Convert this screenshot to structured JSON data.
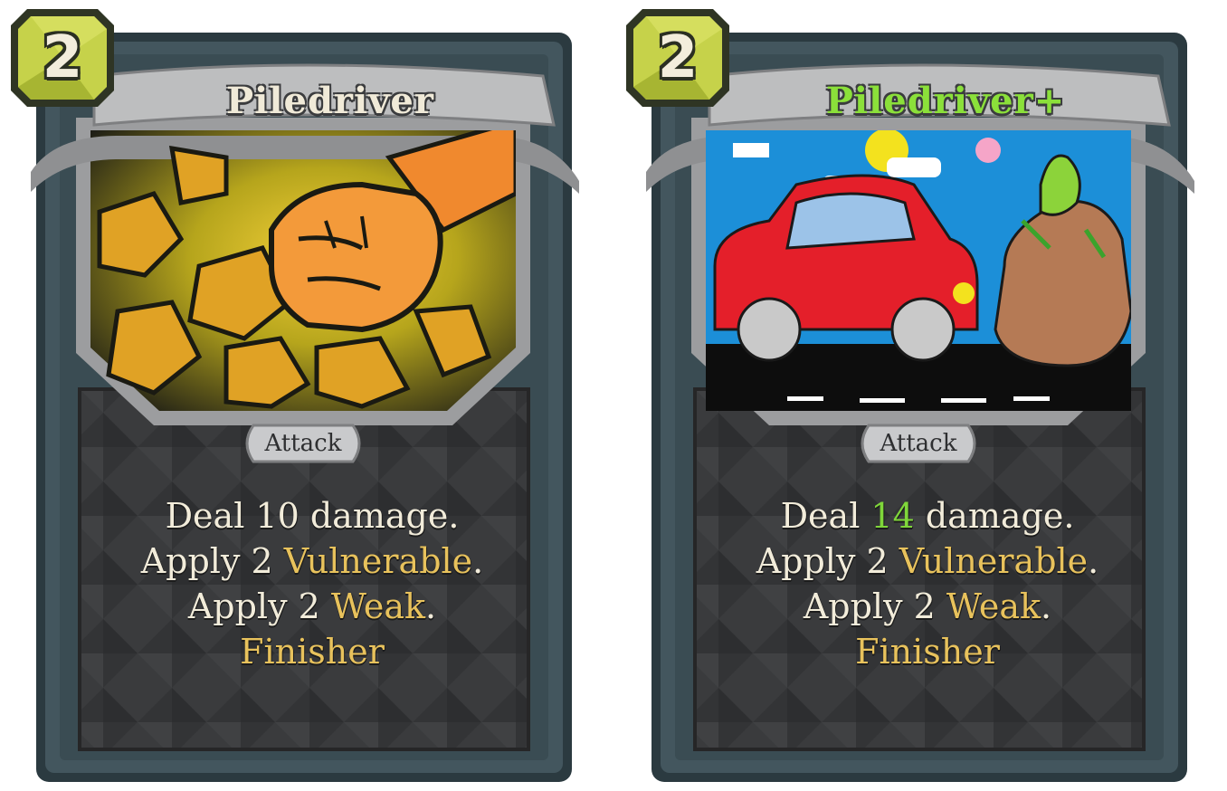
{
  "cards": [
    {
      "cost": "2",
      "name": "Piledriver",
      "type": "Attack",
      "lines": [
        {
          "parts": [
            {
              "text": "Deal 10 damage.",
              "style": "plain"
            }
          ]
        },
        {
          "parts": [
            {
              "text": "Apply 2 ",
              "style": "plain"
            },
            {
              "text": "Vulnerable",
              "style": "keyword"
            },
            {
              "text": ".",
              "style": "plain"
            }
          ]
        },
        {
          "parts": [
            {
              "text": "Apply 2 ",
              "style": "plain"
            },
            {
              "text": "Weak",
              "style": "keyword"
            },
            {
              "text": ".",
              "style": "plain"
            }
          ]
        },
        {
          "parts": [
            {
              "text": "Finisher",
              "style": "keyword"
            }
          ]
        }
      ],
      "art": "fist-smashing-rocks"
    },
    {
      "cost": "2",
      "name": "Piledriver+",
      "type": "Attack",
      "lines": [
        {
          "parts": [
            {
              "text": "Deal ",
              "style": "plain"
            },
            {
              "text": "14",
              "style": "upgraded"
            },
            {
              "text": " damage.",
              "style": "plain"
            }
          ]
        },
        {
          "parts": [
            {
              "text": "Apply 2 ",
              "style": "plain"
            },
            {
              "text": "Vulnerable",
              "style": "keyword"
            },
            {
              "text": ".",
              "style": "plain"
            }
          ]
        },
        {
          "parts": [
            {
              "text": "Apply 2 ",
              "style": "plain"
            },
            {
              "text": "Weak",
              "style": "keyword"
            },
            {
              "text": ".",
              "style": "plain"
            }
          ]
        },
        {
          "parts": [
            {
              "text": "Finisher",
              "style": "keyword"
            }
          ]
        }
      ],
      "art": "red-car-and-rock"
    }
  ],
  "colors": {
    "frame": "#3c5058",
    "frame_dark": "#25343a",
    "banner": "#b9babb",
    "energy": "#c6d24a",
    "keyword": "#e8c25c",
    "upgraded": "#7fd63a",
    "title": "#f0ead8"
  }
}
